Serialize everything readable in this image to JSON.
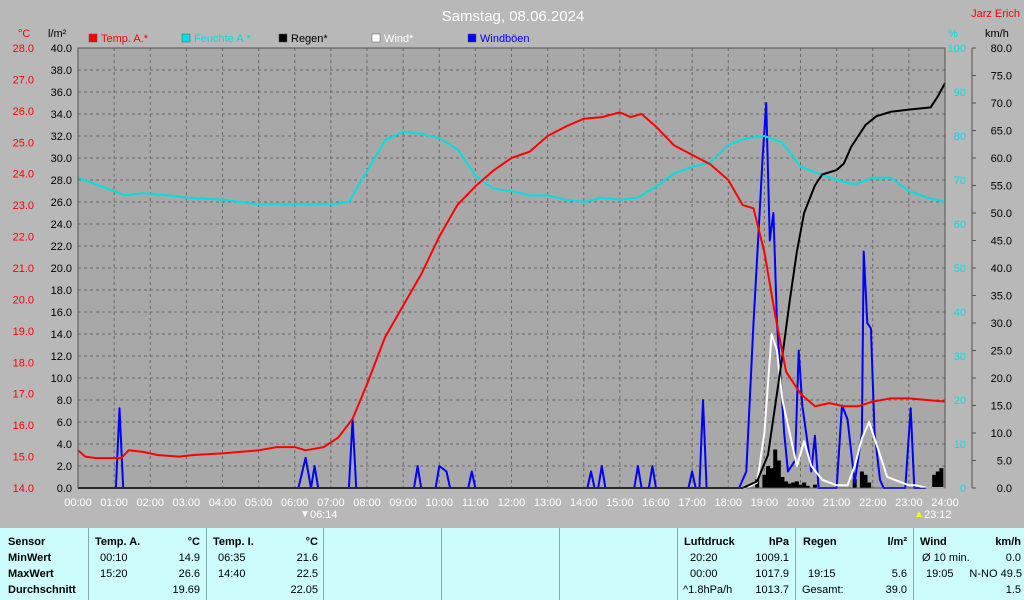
{
  "title": "Samstag, 08.06.2024",
  "station": "Jarz Erich",
  "colors": {
    "background": "#b8b8b8",
    "plot": "#a8a8a8",
    "temp": "#ff0000",
    "humidity": "#00e0e0",
    "rain": "#000000",
    "wind": "#ffffff",
    "gusts": "#0000ff",
    "table": "#ccfcfc"
  },
  "legend": [
    {
      "label": "Temp. A.*",
      "color": "#ff0000"
    },
    {
      "label": "Feuchte A.*",
      "color": "#00e0e0"
    },
    {
      "label": "Regen*",
      "color": "#000000"
    },
    {
      "label": "Wind*",
      "color": "#ffffff"
    },
    {
      "label": "Windböen",
      "color": "#0000ff"
    }
  ],
  "axis_units": {
    "temp": "°C",
    "rain": "l/m²",
    "humidity": "%",
    "wind": "km/h"
  },
  "markers": {
    "sunrise": "06:14",
    "sunset": "23:12"
  },
  "chart_data": {
    "type": "line",
    "x_ticks": [
      "00:00",
      "01:00",
      "02:00",
      "03:00",
      "04:00",
      "05:00",
      "06:00",
      "07:00",
      "08:00",
      "09:00",
      "10:00",
      "11:00",
      "12:00",
      "13:00",
      "14:00",
      "15:00",
      "16:00",
      "17:00",
      "18:00",
      "19:00",
      "20:00",
      "21:00",
      "22:00",
      "23:00",
      "24:00"
    ],
    "temp_axis": {
      "min": 14.0,
      "max": 28.0,
      "step": 1.0,
      "ticks": [
        "14.0",
        "15.0",
        "16.0",
        "17.0",
        "18.0",
        "19.0",
        "20.0",
        "21.0",
        "22.0",
        "23.0",
        "24.0",
        "25.0",
        "26.0",
        "27.0",
        "28.0"
      ]
    },
    "rain_axis": {
      "min": 0.0,
      "max": 40.0,
      "step": 2.0,
      "ticks": [
        "0.0",
        "2.0",
        "4.0",
        "6.0",
        "8.0",
        "10.0",
        "12.0",
        "14.0",
        "16.0",
        "18.0",
        "20.0",
        "22.0",
        "24.0",
        "26.0",
        "28.0",
        "30.0",
        "32.0",
        "34.0",
        "36.0",
        "38.0",
        "40.0"
      ]
    },
    "humidity_axis": {
      "min": 0,
      "max": 100,
      "step": 10,
      "ticks": [
        "0",
        "10",
        "20",
        "30",
        "40",
        "50",
        "60",
        "70",
        "80",
        "90",
        "100"
      ]
    },
    "wind_axis": {
      "min": 0.0,
      "max": 80.0,
      "step": 5.0,
      "ticks": [
        "0.0",
        "5.0",
        "10.0",
        "15.0",
        "20.0",
        "25.0",
        "30.0",
        "35.0",
        "40.0",
        "45.0",
        "50.0",
        "55.0",
        "60.0",
        "65.0",
        "70.0",
        "75.0",
        "80.0"
      ]
    },
    "grid": true,
    "legend_position": "top",
    "series": [
      {
        "name": "Temp. A.*",
        "axis": "temp",
        "color": "#ff0000",
        "points": [
          [
            0,
            15.2
          ],
          [
            0.2,
            15.0
          ],
          [
            0.5,
            14.95
          ],
          [
            1.2,
            14.95
          ],
          [
            1.4,
            15.2
          ],
          [
            1.8,
            15.15
          ],
          [
            2.2,
            15.05
          ],
          [
            2.8,
            15.0
          ],
          [
            3.2,
            15.05
          ],
          [
            4.0,
            15.1
          ],
          [
            5.0,
            15.2
          ],
          [
            5.5,
            15.3
          ],
          [
            6.0,
            15.3
          ],
          [
            6.3,
            15.2
          ],
          [
            6.8,
            15.3
          ],
          [
            7.2,
            15.6
          ],
          [
            7.6,
            16.2
          ],
          [
            8.0,
            17.3
          ],
          [
            8.5,
            18.8
          ],
          [
            9.0,
            19.8
          ],
          [
            9.5,
            20.8
          ],
          [
            10.0,
            22.0
          ],
          [
            10.5,
            23.0
          ],
          [
            11.0,
            23.6
          ],
          [
            11.5,
            24.1
          ],
          [
            12.0,
            24.5
          ],
          [
            12.5,
            24.7
          ],
          [
            13.0,
            25.2
          ],
          [
            13.5,
            25.5
          ],
          [
            14.0,
            25.75
          ],
          [
            14.5,
            25.8
          ],
          [
            15.0,
            25.95
          ],
          [
            15.3,
            25.8
          ],
          [
            15.6,
            25.9
          ],
          [
            16.0,
            25.5
          ],
          [
            16.5,
            24.9
          ],
          [
            17.0,
            24.6
          ],
          [
            17.5,
            24.3
          ],
          [
            18.0,
            23.8
          ],
          [
            18.4,
            23.0
          ],
          [
            18.7,
            22.9
          ],
          [
            19.0,
            21.5
          ],
          [
            19.3,
            19.5
          ],
          [
            19.6,
            17.7
          ],
          [
            20.0,
            17.0
          ],
          [
            20.4,
            16.6
          ],
          [
            20.8,
            16.7
          ],
          [
            21.2,
            16.6
          ],
          [
            21.6,
            16.6
          ],
          [
            22.0,
            16.75
          ],
          [
            22.5,
            16.85
          ],
          [
            23.0,
            16.85
          ],
          [
            23.5,
            16.8
          ],
          [
            24.0,
            16.75
          ]
        ]
      },
      {
        "name": "Feuchte A.*",
        "axis": "humidity",
        "color": "#00e0e0",
        "points": [
          [
            0,
            70.5
          ],
          [
            0.5,
            69.0
          ],
          [
            1.0,
            67.5
          ],
          [
            1.3,
            66.5
          ],
          [
            1.8,
            67.0
          ],
          [
            2.5,
            66.5
          ],
          [
            3.0,
            66.0
          ],
          [
            4.0,
            65.5
          ],
          [
            5.0,
            64.5
          ],
          [
            6.0,
            64.5
          ],
          [
            6.5,
            64.5
          ],
          [
            7.0,
            64.5
          ],
          [
            7.5,
            65.0
          ],
          [
            8.0,
            72.0
          ],
          [
            8.5,
            79.0
          ],
          [
            9.0,
            81.0
          ],
          [
            9.5,
            80.5
          ],
          [
            10.0,
            79.5
          ],
          [
            10.5,
            77.0
          ],
          [
            11.0,
            71.0
          ],
          [
            11.5,
            68.0
          ],
          [
            12.0,
            67.5
          ],
          [
            12.5,
            66.5
          ],
          [
            13.0,
            66.5
          ],
          [
            13.5,
            65.5
          ],
          [
            14.0,
            65.0
          ],
          [
            14.5,
            66.0
          ],
          [
            15.0,
            65.5
          ],
          [
            15.5,
            66.0
          ],
          [
            16.0,
            68.5
          ],
          [
            16.5,
            71.5
          ],
          [
            17.0,
            73.0
          ],
          [
            17.5,
            74.0
          ],
          [
            18.0,
            78.0
          ],
          [
            18.5,
            79.5
          ],
          [
            19.0,
            80.0
          ],
          [
            19.5,
            78.5
          ],
          [
            20.0,
            73.0
          ],
          [
            20.5,
            71.5
          ],
          [
            21.0,
            70.0
          ],
          [
            21.5,
            69.0
          ],
          [
            22.0,
            70.5
          ],
          [
            22.5,
            70.5
          ],
          [
            23.0,
            67.5
          ],
          [
            23.5,
            66.0
          ],
          [
            24.0,
            65.0
          ]
        ]
      },
      {
        "name": "Regen*",
        "axis": "rain",
        "color": "#000000",
        "points": [
          [
            0,
            0
          ],
          [
            18.4,
            0
          ],
          [
            18.8,
            0.6
          ],
          [
            19.1,
            3.0
          ],
          [
            19.3,
            7.5
          ],
          [
            19.5,
            12.0
          ],
          [
            19.7,
            17.0
          ],
          [
            19.9,
            21.5
          ],
          [
            20.1,
            25.0
          ],
          [
            20.4,
            27.5
          ],
          [
            20.6,
            28.5
          ],
          [
            21.0,
            28.9
          ],
          [
            21.2,
            29.5
          ],
          [
            21.4,
            31.0
          ],
          [
            21.6,
            32.0
          ],
          [
            21.8,
            33.0
          ],
          [
            22.1,
            33.8
          ],
          [
            22.5,
            34.2
          ],
          [
            23.0,
            34.4
          ],
          [
            23.6,
            34.6
          ],
          [
            23.8,
            35.6
          ],
          [
            24.0,
            36.8
          ]
        ]
      },
      {
        "name": "Wind*",
        "axis": "wind",
        "color": "#ffffff",
        "points": [
          [
            0,
            0
          ],
          [
            18.5,
            0
          ],
          [
            18.8,
            1.0
          ],
          [
            19.0,
            10.0
          ],
          [
            19.2,
            28.0
          ],
          [
            19.35,
            25.0
          ],
          [
            19.5,
            16.0
          ],
          [
            19.7,
            10.0
          ],
          [
            19.9,
            4.0
          ],
          [
            20.1,
            8.5
          ],
          [
            20.3,
            4.0
          ],
          [
            20.6,
            1.5
          ],
          [
            21.0,
            0.5
          ],
          [
            21.3,
            0.5
          ],
          [
            21.5,
            4.0
          ],
          [
            21.7,
            9.0
          ],
          [
            21.9,
            12.0
          ],
          [
            22.1,
            8.0
          ],
          [
            22.4,
            2.0
          ],
          [
            23.0,
            0.5
          ],
          [
            23.2,
            0.5
          ],
          [
            23.5,
            0
          ],
          [
            24.0,
            0
          ]
        ]
      },
      {
        "name": "Windböen",
        "axis": "wind",
        "color": "#0000ff",
        "points": [
          [
            0,
            0
          ],
          [
            1.05,
            0
          ],
          [
            1.15,
            14.5
          ],
          [
            1.25,
            0
          ],
          [
            6.1,
            0
          ],
          [
            6.3,
            5.5
          ],
          [
            6.45,
            0
          ],
          [
            6.55,
            4.0
          ],
          [
            6.65,
            0
          ],
          [
            7.5,
            0
          ],
          [
            7.6,
            12.5
          ],
          [
            7.7,
            0
          ],
          [
            9.3,
            0
          ],
          [
            9.4,
            4.0
          ],
          [
            9.5,
            0
          ],
          [
            9.9,
            0
          ],
          [
            10.0,
            4.0
          ],
          [
            10.2,
            3.0
          ],
          [
            10.3,
            0
          ],
          [
            10.8,
            0
          ],
          [
            10.9,
            3.0
          ],
          [
            11.0,
            0
          ],
          [
            14.1,
            0
          ],
          [
            14.2,
            3.0
          ],
          [
            14.3,
            0
          ],
          [
            14.4,
            0
          ],
          [
            14.5,
            4.0
          ],
          [
            14.6,
            0
          ],
          [
            15.4,
            0
          ],
          [
            15.5,
            4.0
          ],
          [
            15.6,
            0
          ],
          [
            15.8,
            0
          ],
          [
            15.9,
            4.0
          ],
          [
            16.0,
            0
          ],
          [
            16.9,
            0
          ],
          [
            17.0,
            3.0
          ],
          [
            17.1,
            0
          ],
          [
            17.2,
            0
          ],
          [
            17.3,
            16.0
          ],
          [
            17.4,
            0
          ],
          [
            18.3,
            0
          ],
          [
            18.5,
            3.0
          ],
          [
            18.7,
            30.0
          ],
          [
            18.85,
            48.0
          ],
          [
            18.95,
            60.0
          ],
          [
            19.05,
            70.0
          ],
          [
            19.15,
            45.0
          ],
          [
            19.25,
            50.0
          ],
          [
            19.35,
            30.0
          ],
          [
            19.45,
            20.0
          ],
          [
            19.55,
            10.0
          ],
          [
            19.65,
            3.0
          ],
          [
            19.85,
            5.0
          ],
          [
            19.95,
            25.0
          ],
          [
            20.05,
            15.0
          ],
          [
            20.2,
            8.0
          ],
          [
            20.3,
            3.0
          ],
          [
            20.4,
            9.5
          ],
          [
            20.5,
            0
          ],
          [
            21.0,
            0
          ],
          [
            21.15,
            15.0
          ],
          [
            21.3,
            12.5
          ],
          [
            21.5,
            1.0
          ],
          [
            21.7,
            10.0
          ],
          [
            21.75,
            43.0
          ],
          [
            21.85,
            30.0
          ],
          [
            21.95,
            29.0
          ],
          [
            22.05,
            10.0
          ],
          [
            22.2,
            1.5
          ],
          [
            22.3,
            0
          ],
          [
            22.9,
            0
          ],
          [
            23.05,
            14.5
          ],
          [
            23.15,
            0
          ],
          [
            24.0,
            0
          ]
        ]
      }
    ],
    "rain_bars": [
      [
        18.8,
        0.8
      ],
      [
        19.0,
        1.2
      ],
      [
        19.1,
        2.0
      ],
      [
        19.2,
        1.8
      ],
      [
        19.3,
        3.5
      ],
      [
        19.4,
        2.5
      ],
      [
        19.5,
        1.0
      ],
      [
        19.6,
        0.6
      ],
      [
        19.7,
        0.4
      ],
      [
        19.8,
        0.5
      ],
      [
        19.9,
        0.6
      ],
      [
        20.0,
        0.3
      ],
      [
        20.1,
        0.5
      ],
      [
        20.2,
        0.2
      ],
      [
        20.4,
        0.3
      ],
      [
        21.5,
        0.8
      ],
      [
        21.7,
        1.5
      ],
      [
        21.8,
        1.2
      ],
      [
        21.9,
        0.5
      ],
      [
        23.7,
        1.2
      ],
      [
        23.8,
        1.5
      ],
      [
        23.9,
        1.8
      ]
    ]
  },
  "table": {
    "row_labels": [
      "Sensor",
      "MinWert",
      "MaxWert",
      "Durchschnitt"
    ],
    "temp_a": {
      "header": "Temp. A.",
      "unit": "°C",
      "min_time": "00:10",
      "min": "14.9",
      "max_time": "15:20",
      "max": "26.6",
      "avg": "19.69"
    },
    "temp_i": {
      "header": "Temp. I.",
      "unit": "°C",
      "min_time": "06:35",
      "min": "21.6",
      "max_time": "14:40",
      "max": "22.5",
      "avg": "22.05"
    },
    "pressure": {
      "header": "Luftdruck",
      "unit": "hPa",
      "min_time": "20:20",
      "min": "1009.1",
      "max_time": "00:00",
      "max": "1017.9",
      "trend": "^1.8hPa/h",
      "avg": "1013.7"
    },
    "rain": {
      "header": "Regen",
      "unit": "l/m²",
      "max_time": "19:15",
      "max": "5.6",
      "total_label": "Gesamt:",
      "total": "39.0"
    },
    "wind": {
      "header": "Wind",
      "unit": "km/h",
      "avg_label": "Ø 10 min.",
      "avg": "0.0",
      "max_time": "19:05",
      "max": "N-NO 49.5",
      "extra": "1.5"
    }
  }
}
